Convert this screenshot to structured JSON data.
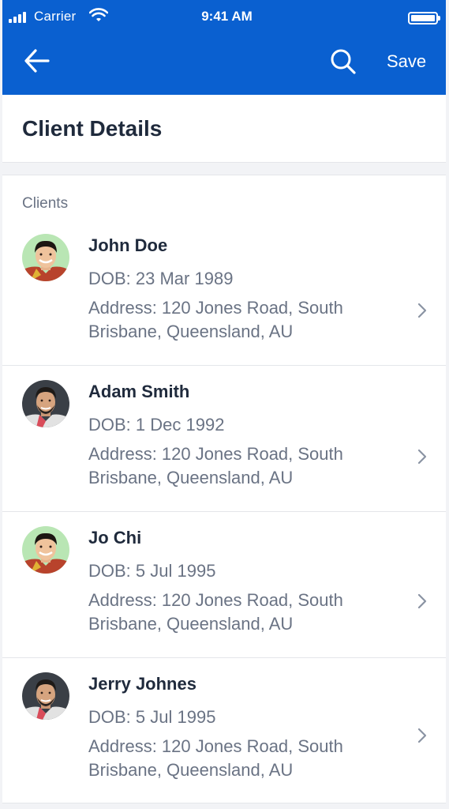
{
  "status_bar": {
    "carrier": "Carrier",
    "time": "9:41 AM"
  },
  "nav_bar": {
    "back_icon": "arrow-left-icon",
    "search_icon": "search-icon",
    "save_label": "Save"
  },
  "header": {
    "title": "Client Details"
  },
  "clients_section": {
    "label": "Clients",
    "items": [
      {
        "name": "John Doe",
        "dob": "DOB: 23 Mar 1989",
        "address": "Address: 120 Jones Road, South Brisbane, Queensland, AU",
        "avatar_bg": "#b9e6b4"
      },
      {
        "name": "Adam Smith",
        "dob": "DOB: 1 Dec 1992",
        "address": "Address: 120 Jones Road, South Brisbane, Queensland, AU",
        "avatar_bg": "#3a3f46"
      },
      {
        "name": "Jo Chi",
        "dob": "DOB: 5 Jul 1995",
        "address": "Address: 120 Jones Road, South Brisbane, Queensland, AU",
        "avatar_bg": "#b9e6b4"
      },
      {
        "name": "Jerry Johnes",
        "dob": "DOB: 5 Jul 1995",
        "address": "Address: 120 Jones Road, South Brisbane, Queensland, AU",
        "avatar_bg": "#3a3f46"
      }
    ]
  },
  "colors": {
    "primary": "#0a60d0",
    "text_dark": "#1f2a3c",
    "text_muted": "#6a7384",
    "chevron": "#8a93a3"
  }
}
